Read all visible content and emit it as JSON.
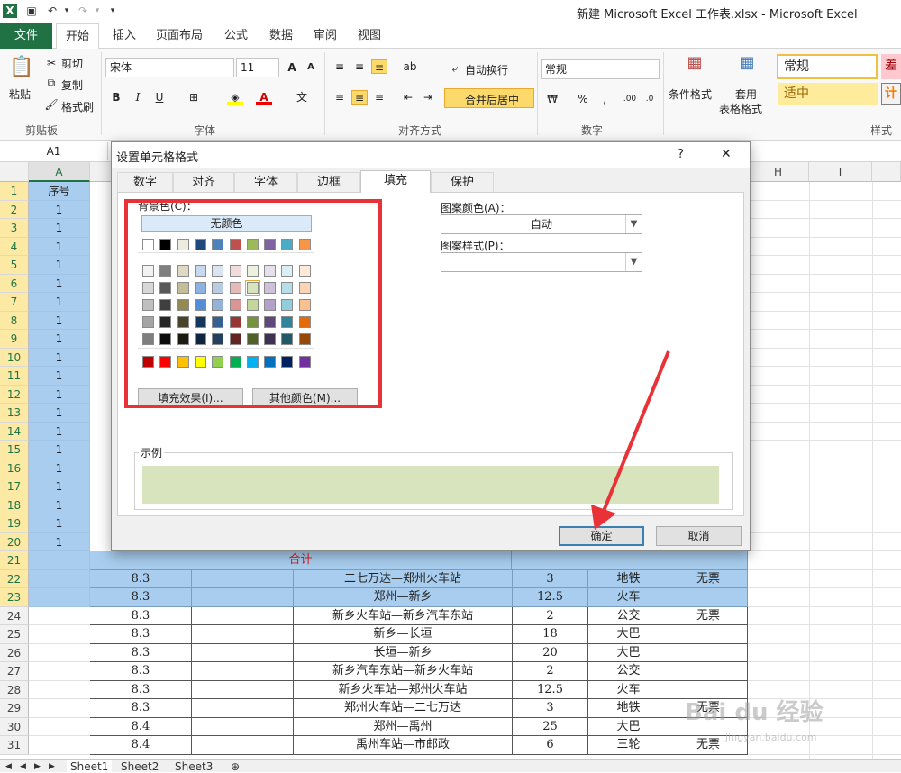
{
  "titlebar": {
    "title": "新建 Microsoft Excel 工作表.xlsx - Microsoft Excel"
  },
  "ribbon_tabs": [
    "文件",
    "开始",
    "插入",
    "页面布局",
    "公式",
    "数据",
    "审阅",
    "视图"
  ],
  "ribbon": {
    "paste": "粘贴",
    "cut": "剪切",
    "copy": "复制",
    "format_painter": "格式刷",
    "clipboard_label": "剪贴板",
    "font_name": "宋体",
    "font_size": "11",
    "font_label": "字体",
    "wrap_text": "自动换行",
    "merge_center": "合并后居中",
    "align_label": "对齐方式",
    "number_format": "常规",
    "number_label": "数字",
    "cond_format": "条件格式",
    "table_format_1": "套用",
    "table_format_2": "表格格式",
    "style_normal": "常规",
    "style_bad": "差",
    "style_neutral": "适中",
    "style_calc": "计",
    "style_label": "样式"
  },
  "formula_bar": {
    "name_box": "A1"
  },
  "grid": {
    "columns": [
      "A",
      "H",
      "I"
    ],
    "row_numbers": [
      "1",
      "2",
      "3",
      "4",
      "5",
      "6",
      "7",
      "8",
      "9",
      "10",
      "11",
      "12",
      "13",
      "14",
      "15",
      "16",
      "17",
      "18",
      "19",
      "20",
      "21",
      "22",
      "23",
      "24",
      "25",
      "26",
      "27",
      "28",
      "29",
      "30",
      "31"
    ],
    "colA": [
      "序号",
      "1",
      "1",
      "1",
      "1",
      "1",
      "1",
      "1",
      "1",
      "1",
      "1",
      "1",
      "1",
      "1",
      "1",
      "1",
      "1",
      "1",
      "1",
      "1"
    ],
    "total_label": "合计",
    "rows": [
      {
        "r": "22",
        "b": "8.3",
        "d": "二七万达—郑州火车站",
        "e": "3",
        "f": "地铁",
        "g": "无票"
      },
      {
        "r": "23",
        "b": "8.3",
        "d": "郑州—新乡",
        "e": "12.5",
        "f": "火车",
        "g": ""
      },
      {
        "r": "24",
        "b": "8.3",
        "d": "新乡火车站—新乡汽车东站",
        "e": "2",
        "f": "公交",
        "g": "无票"
      },
      {
        "r": "25",
        "b": "8.3",
        "d": "新乡—长垣",
        "e": "18",
        "f": "大巴",
        "g": ""
      },
      {
        "r": "26",
        "b": "8.3",
        "d": "长垣—新乡",
        "e": "20",
        "f": "大巴",
        "g": ""
      },
      {
        "r": "27",
        "b": "8.3",
        "d": "新乡汽车东站—新乡火车站",
        "e": "2",
        "f": "公交",
        "g": ""
      },
      {
        "r": "28",
        "b": "8.3",
        "d": "新乡火车站—郑州火车站",
        "e": "12.5",
        "f": "火车",
        "g": ""
      },
      {
        "r": "29",
        "b": "8.3",
        "d": "郑州火车站—二七万达",
        "e": "3",
        "f": "地铁",
        "g": "无票"
      },
      {
        "r": "30",
        "b": "8.4",
        "d": "郑州—禹州",
        "e": "25",
        "f": "大巴",
        "g": ""
      },
      {
        "r": "31",
        "b": "8.4",
        "d": "禹州车站—市邮政",
        "e": "6",
        "f": "三轮",
        "g": "无票"
      }
    ]
  },
  "sheets": [
    "Sheet1",
    "Sheet2",
    "Sheet3"
  ],
  "dialog": {
    "title": "设置单元格格式",
    "help": "?",
    "close": "✕",
    "tabs": [
      "数字",
      "对齐",
      "字体",
      "边框",
      "填充",
      "保护"
    ],
    "bg_color_label": "背景色(C)：",
    "no_color": "无颜色",
    "fill_effects": "填充效果(I)...",
    "more_colors": "其他颜色(M)...",
    "pattern_color_label": "图案颜色(A)：",
    "pattern_color_value": "自动",
    "pattern_style_label": "图案样式(P)：",
    "sample_label": "示例",
    "sample_color": "#d7e4bd",
    "ok": "确定",
    "cancel": "取消",
    "theme_row": [
      "#ffffff",
      "#000000",
      "#eeece1",
      "#1f497d",
      "#4f81bd",
      "#c0504d",
      "#9bbb59",
      "#8064a2",
      "#4bacc6",
      "#f79646"
    ],
    "tint_rows": [
      [
        "#f2f2f2",
        "#7f7f7f",
        "#ddd9c3",
        "#c6d9f0",
        "#dbe5f1",
        "#f2dcdb",
        "#ebf1dd",
        "#e5e0ec",
        "#dbeef3",
        "#fdeada"
      ],
      [
        "#d8d8d8",
        "#595959",
        "#c4bd97",
        "#8db3e2",
        "#b8cce4",
        "#e5b9b7",
        "#d7e3bc",
        "#ccc1d9",
        "#b7dde8",
        "#fbd5b5"
      ],
      [
        "#bfbfbf",
        "#3f3f3f",
        "#938953",
        "#548dd4",
        "#95b3d7",
        "#d99694",
        "#c3d69b",
        "#b2a2c7",
        "#92cddc",
        "#fac08f"
      ],
      [
        "#a5a5a5",
        "#262626",
        "#494429",
        "#17365d",
        "#366092",
        "#953734",
        "#76923c",
        "#5f497a",
        "#31859b",
        "#e36c09"
      ],
      [
        "#7f7f7f",
        "#0c0c0c",
        "#1d1b10",
        "#0f243e",
        "#244061",
        "#632423",
        "#4f6128",
        "#3f3151",
        "#205867",
        "#974806"
      ]
    ],
    "standard_row": [
      "#c00000",
      "#ff0000",
      "#ffc000",
      "#ffff00",
      "#92d050",
      "#00b050",
      "#00b0f0",
      "#0070c0",
      "#002060",
      "#7030a0"
    ]
  },
  "watermark": {
    "brand": "Bai du 经验",
    "url": "jingyan.baidu.com"
  }
}
